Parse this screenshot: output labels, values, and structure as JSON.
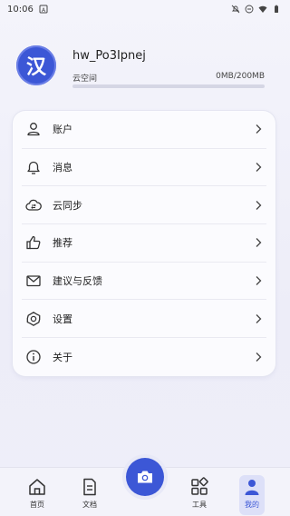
{
  "status_bar": {
    "time": "10:06"
  },
  "profile": {
    "avatar_char": "汉",
    "username": "hw_Po3Ipnej",
    "storage_label": "云空间",
    "storage_value": "0MB/200MB",
    "storage_used_fraction": 0.0
  },
  "menu": {
    "items": [
      {
        "label": "账户",
        "icon": "user-icon"
      },
      {
        "label": "消息",
        "icon": "bell-icon"
      },
      {
        "label": "云同步",
        "icon": "cloud-sync-icon"
      },
      {
        "label": "推荐",
        "icon": "thumbs-up-icon"
      },
      {
        "label": "建议与反馈",
        "icon": "mail-icon"
      },
      {
        "label": "设置",
        "icon": "gear-icon"
      },
      {
        "label": "关于",
        "icon": "info-icon"
      }
    ]
  },
  "tab_bar": {
    "tabs": [
      {
        "label": "首页",
        "icon": "home-icon"
      },
      {
        "label": "文档",
        "icon": "document-icon"
      },
      {
        "label": "工具",
        "icon": "tools-grid-icon"
      },
      {
        "label": "我的",
        "icon": "person-icon"
      }
    ],
    "active_tab": "我的",
    "center_button_icon": "camera-icon"
  },
  "colors": {
    "accent": "#3c57d6",
    "background": "#f0f0fa"
  }
}
